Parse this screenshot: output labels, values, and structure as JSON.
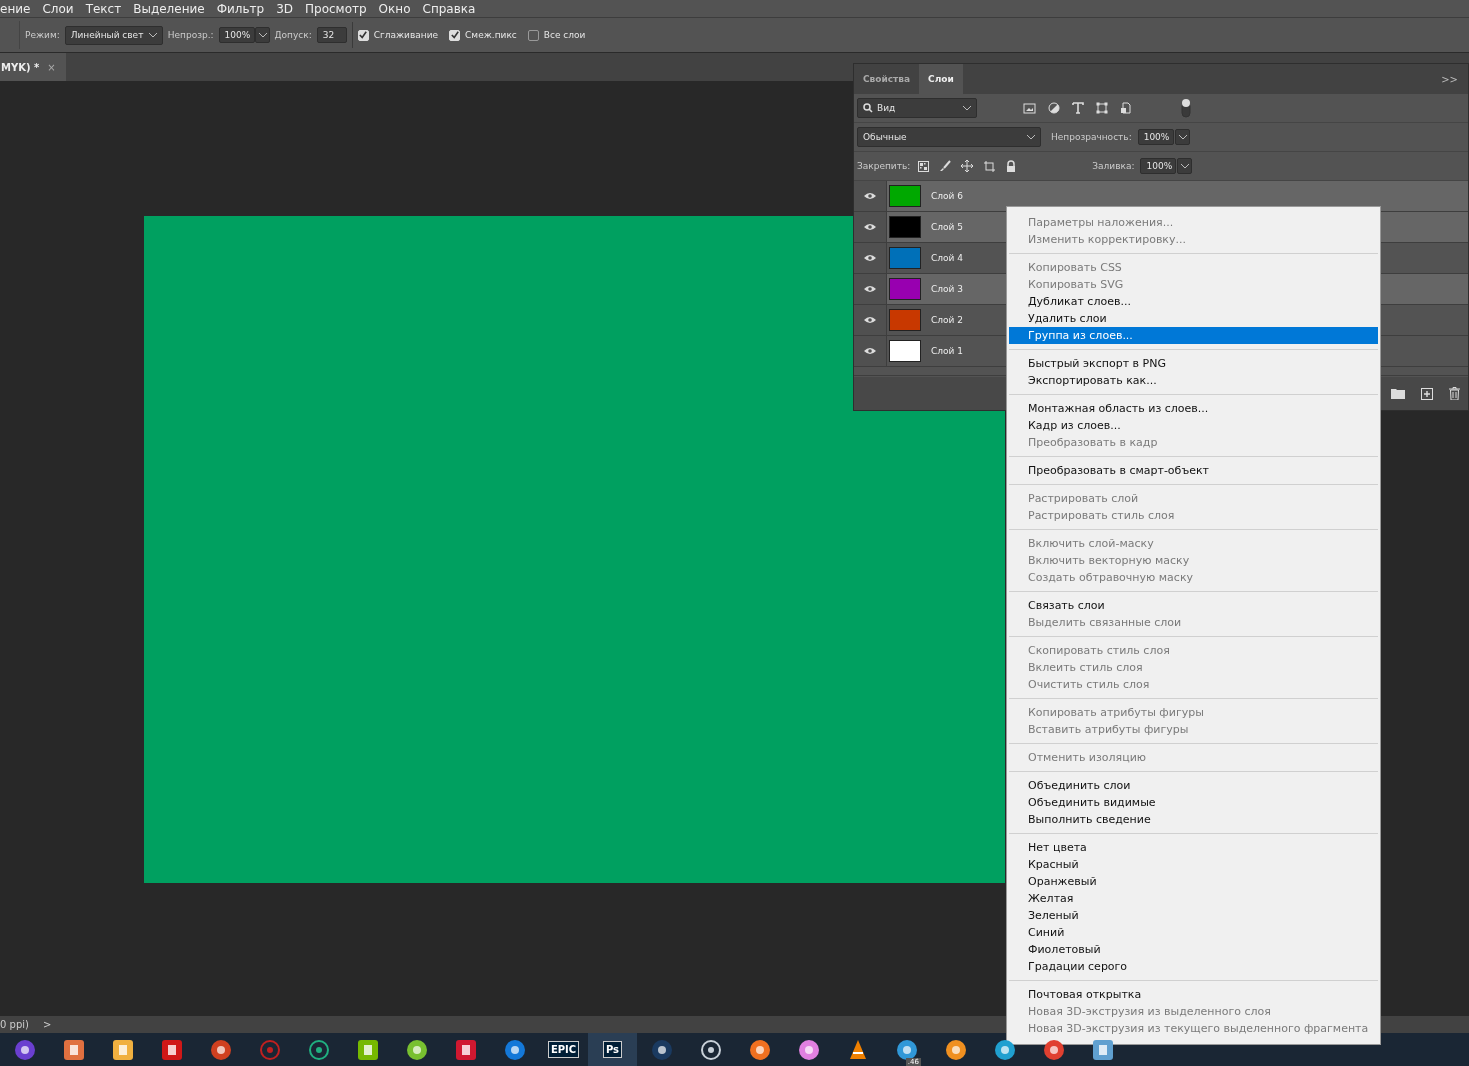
{
  "menu_bar": [
    "ение",
    "Слои",
    "Текст",
    "Выделение",
    "Фильтр",
    "3D",
    "Просмотр",
    "Окно",
    "Справка"
  ],
  "options_bar": {
    "mode_label": "Режим:",
    "mode_value": "Линейный свет",
    "opacity_label": "Непрозр.:",
    "opacity_value": "100%",
    "tolerance_label": "Допуск:",
    "tolerance_value": "32",
    "checkboxes": [
      {
        "label": "Сглаживание",
        "checked": true
      },
      {
        "label": "Смеж.пикс",
        "checked": true
      },
      {
        "label": "Все слои",
        "checked": false
      }
    ]
  },
  "document_tab": {
    "title": "MYK) *",
    "close": "×"
  },
  "layers_panel": {
    "tabs": [
      {
        "label": "Свойства",
        "selected": false
      },
      {
        "label": "Слои",
        "selected": true
      }
    ],
    "collapse": ">>",
    "filter_value": "Вид",
    "blend_mode": "Обычные",
    "opacity_label": "Непрозрачность:",
    "opacity_value": "100%",
    "lock_label": "Закрепить:",
    "fill_label": "Заливка:",
    "fill_value": "100%",
    "layers": [
      {
        "name": "Слой 6",
        "color": "#00a800",
        "selected": true
      },
      {
        "name": "Слой 5",
        "color": "#000000",
        "selected": true
      },
      {
        "name": "Слой 4",
        "color": "#0070b8",
        "selected": false
      },
      {
        "name": "Слой 3",
        "color": "#9800b0",
        "selected": true
      },
      {
        "name": "Слой 2",
        "color": "#c83800",
        "selected": false
      },
      {
        "name": "Слой 1",
        "color": "#ffffff",
        "selected": false
      }
    ]
  },
  "context_menu": [
    [
      {
        "label": "Параметры наложения...",
        "disabled": true,
        "selected": false
      },
      {
        "label": "Изменить корректировку...",
        "disabled": true,
        "selected": false
      }
    ],
    [
      {
        "label": "Копировать CSS",
        "disabled": true,
        "selected": false
      },
      {
        "label": "Копировать SVG",
        "disabled": true,
        "selected": false
      },
      {
        "label": "Дубликат слоев...",
        "disabled": false,
        "selected": false
      },
      {
        "label": "Удалить слои",
        "disabled": false,
        "selected": false
      },
      {
        "label": "Группа из слоев...",
        "disabled": false,
        "selected": true
      }
    ],
    [
      {
        "label": "Быстрый экспорт в PNG",
        "disabled": false,
        "selected": false
      },
      {
        "label": "Экспортировать как...",
        "disabled": false,
        "selected": false
      }
    ],
    [
      {
        "label": "Монтажная область из слоев...",
        "disabled": false,
        "selected": false
      },
      {
        "label": "Кадр из слоев...",
        "disabled": false,
        "selected": false
      },
      {
        "label": "Преобразовать в кадр",
        "disabled": true,
        "selected": false
      }
    ],
    [
      {
        "label": "Преобразовать в смарт-объект",
        "disabled": false,
        "selected": false
      }
    ],
    [
      {
        "label": "Растрировать слой",
        "disabled": true,
        "selected": false
      },
      {
        "label": "Растрировать стиль слоя",
        "disabled": true,
        "selected": false
      }
    ],
    [
      {
        "label": "Включить слой-маску",
        "disabled": true,
        "selected": false
      },
      {
        "label": "Включить векторную маску",
        "disabled": true,
        "selected": false
      },
      {
        "label": "Создать обтравочную маску",
        "disabled": true,
        "selected": false
      }
    ],
    [
      {
        "label": "Связать слои",
        "disabled": false,
        "selected": false
      },
      {
        "label": "Выделить связанные слои",
        "disabled": true,
        "selected": false
      }
    ],
    [
      {
        "label": "Скопировать стиль слоя",
        "disabled": true,
        "selected": false
      },
      {
        "label": "Вклеить стиль слоя",
        "disabled": true,
        "selected": false
      },
      {
        "label": "Очистить стиль слоя",
        "disabled": true,
        "selected": false
      }
    ],
    [
      {
        "label": "Копировать атрибуты фигуры",
        "disabled": true,
        "selected": false
      },
      {
        "label": "Вставить атрибуты фигуры",
        "disabled": true,
        "selected": false
      }
    ],
    [
      {
        "label": "Отменить изоляцию",
        "disabled": true,
        "selected": false
      }
    ],
    [
      {
        "label": "Объединить слои",
        "disabled": false,
        "selected": false
      },
      {
        "label": "Объединить видимые",
        "disabled": false,
        "selected": false
      },
      {
        "label": "Выполнить сведение",
        "disabled": false,
        "selected": false
      }
    ],
    [
      {
        "label": "Нет цвета",
        "disabled": false,
        "selected": false
      },
      {
        "label": "Красный",
        "disabled": false,
        "selected": false
      },
      {
        "label": "Оранжевый",
        "disabled": false,
        "selected": false
      },
      {
        "label": "Желтая",
        "disabled": false,
        "selected": false
      },
      {
        "label": "Зеленый",
        "disabled": false,
        "selected": false
      },
      {
        "label": "Синий",
        "disabled": false,
        "selected": false
      },
      {
        "label": "Фиолетовый",
        "disabled": false,
        "selected": false
      },
      {
        "label": "Градации серого",
        "disabled": false,
        "selected": false
      }
    ],
    [
      {
        "label": "Почтовая открытка",
        "disabled": false,
        "selected": false
      },
      {
        "label": "Новая 3D-экструзия из выделенного слоя",
        "disabled": true,
        "selected": false
      },
      {
        "label": "Новая 3D-экструзия из текущего выделенного фрагмента",
        "disabled": true,
        "selected": false
      }
    ]
  ],
  "status_bar": {
    "text": "0 ppi)",
    "arrow": ">"
  },
  "taskbar": [
    {
      "color": "#6a3fd0",
      "kind": "circle"
    },
    {
      "color": "#e07040",
      "kind": "square"
    },
    {
      "color": "#f0b040",
      "kind": "square"
    },
    {
      "color": "#d01818",
      "kind": "square"
    },
    {
      "color": "#d04020",
      "kind": "circle"
    },
    {
      "color": "#c02020",
      "kind": "ring"
    },
    {
      "color": "#20b080",
      "kind": "ring"
    },
    {
      "color": "#76b900",
      "kind": "square"
    },
    {
      "color": "#78c030",
      "kind": "circle"
    },
    {
      "color": "#d01830",
      "kind": "square"
    },
    {
      "color": "#1478d8",
      "kind": "circle"
    },
    {
      "kind": "label",
      "label": "EPIC"
    },
    {
      "kind": "label",
      "label": "Ps",
      "selected": true
    },
    {
      "color": "#1a3a60",
      "kind": "circle"
    },
    {
      "color": "#c8d0d8",
      "kind": "ring"
    },
    {
      "color": "#f07020",
      "kind": "circle"
    },
    {
      "color": "#e080e0",
      "kind": "circle"
    },
    {
      "color": "#f08000",
      "kind": "cone"
    },
    {
      "color": "#3098d8",
      "kind": "circle",
      "badge": ".46"
    },
    {
      "color": "#f09020",
      "kind": "circle"
    },
    {
      "color": "#20a0d0",
      "kind": "circle"
    },
    {
      "color": "#e04030",
      "kind": "circle"
    },
    {
      "color": "#60a0d0",
      "kind": "square"
    }
  ]
}
